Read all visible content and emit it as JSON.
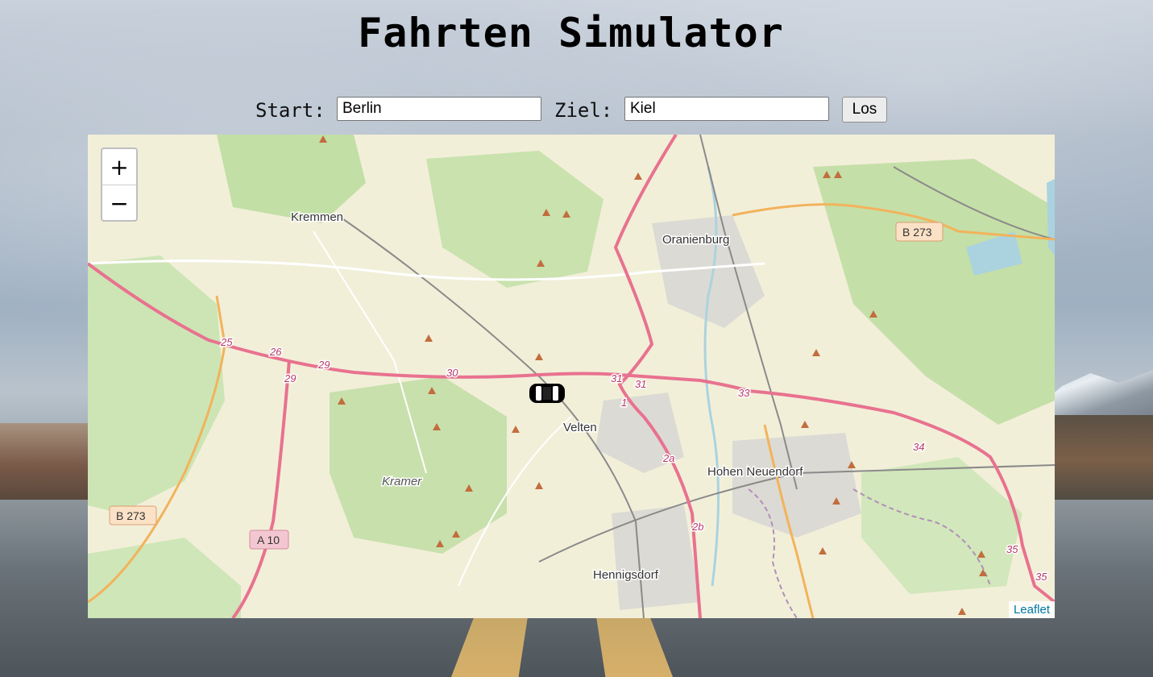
{
  "header": {
    "title": "Fahrten Simulator"
  },
  "form": {
    "start_label": "Start:",
    "start_value": "Berlin",
    "ziel_label": "Ziel:",
    "ziel_value": "Kiel",
    "submit_label": "Los"
  },
  "map": {
    "zoom_in": "+",
    "zoom_out": "−",
    "attribution": "Leaflet",
    "places": [
      "Kremmen",
      "Oranienburg",
      "Velten",
      "Hohen Neuendorf",
      "Hennigsdorf",
      "Kramer"
    ],
    "road_labels": [
      "B 273",
      "B 273",
      "A 10"
    ],
    "exit_numbers": [
      "25",
      "26",
      "29",
      "29",
      "30",
      "31",
      "31",
      "1",
      "33",
      "2a",
      "2b",
      "34",
      "35",
      "35"
    ]
  },
  "colors": {
    "motorway": "#e8728f",
    "primary": "#f2b35c",
    "forest": "#add19e",
    "water": "#aad3df"
  }
}
